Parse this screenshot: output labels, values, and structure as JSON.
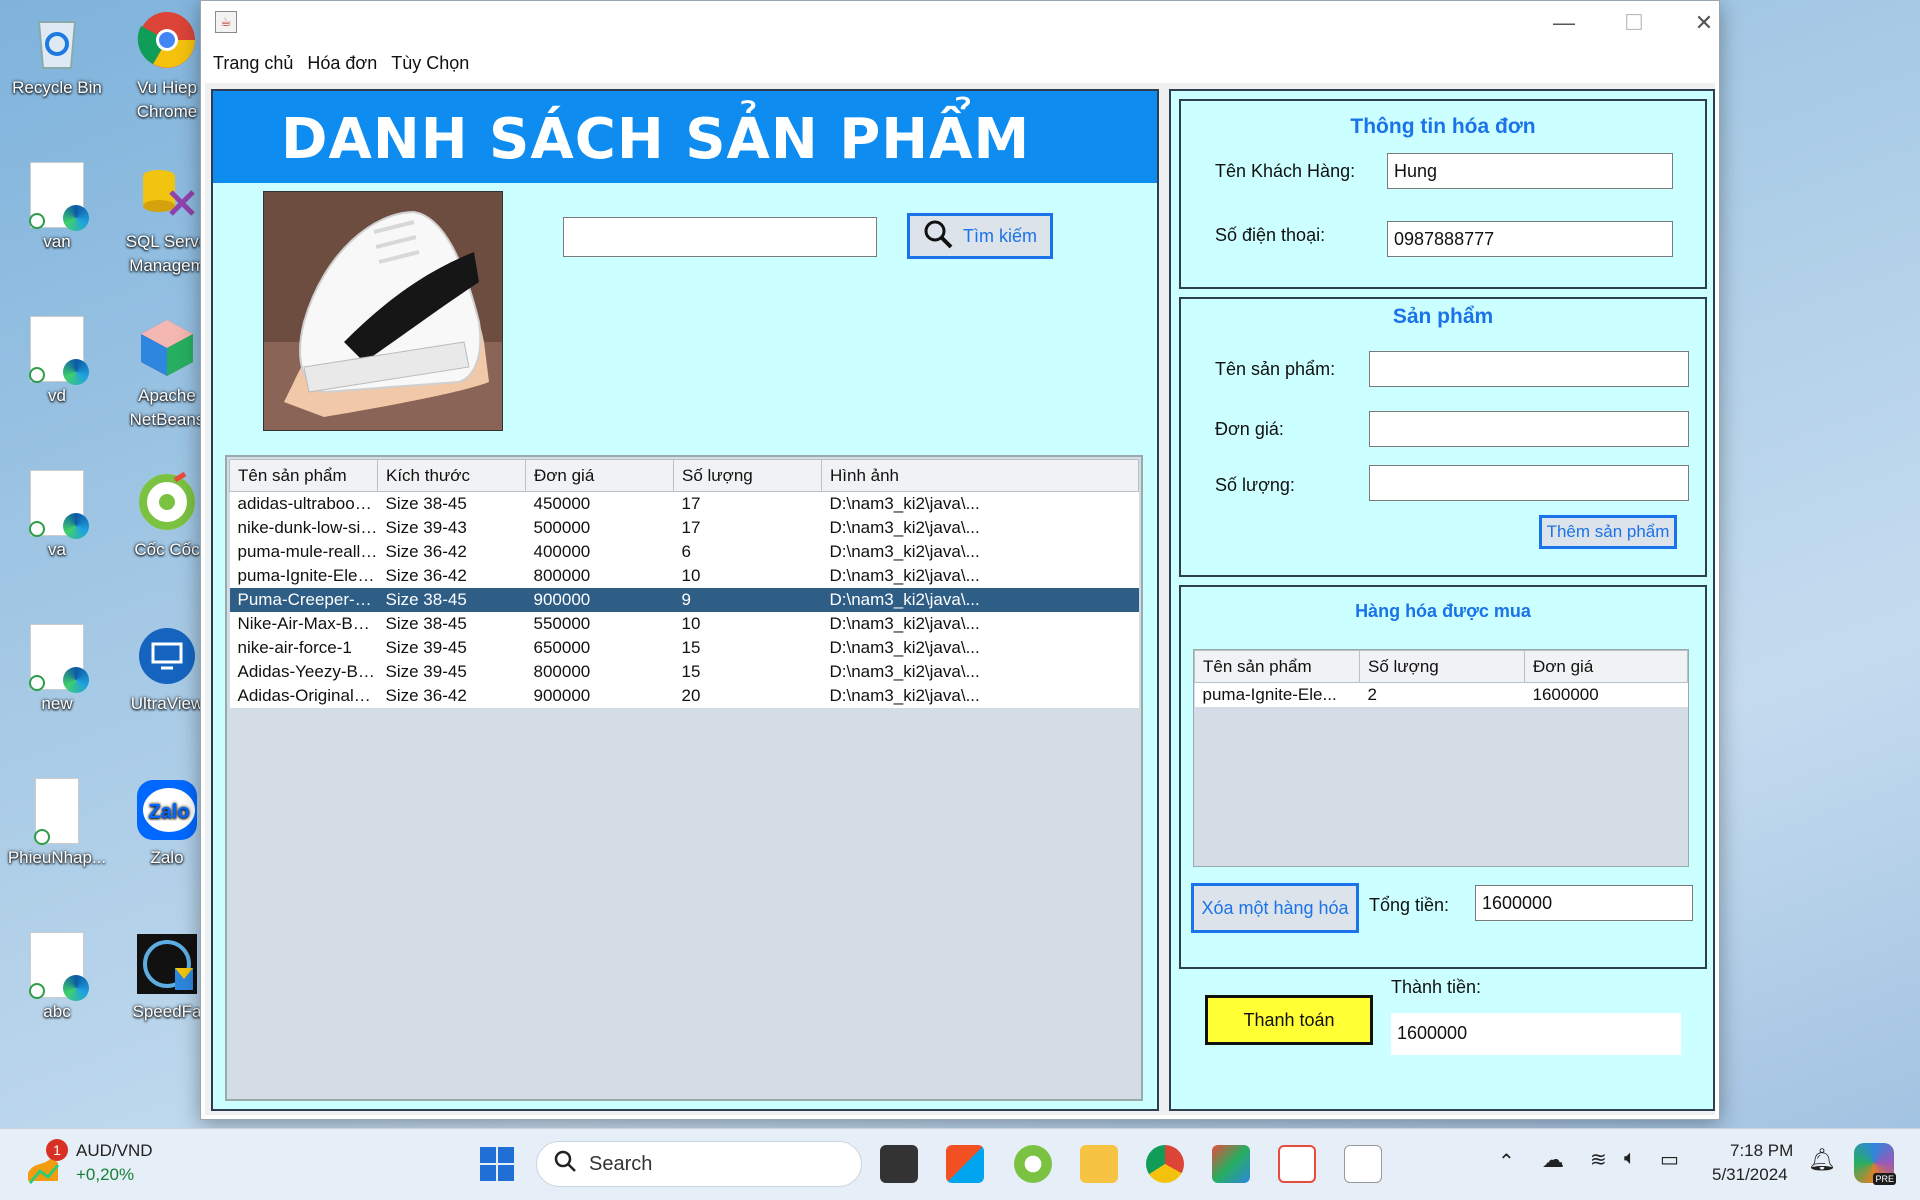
{
  "desktop": {
    "icons": [
      {
        "label": "Recycle Bin"
      },
      {
        "label": "Vu Hiep\nChrome"
      },
      {
        "label": "van"
      },
      {
        "label": "SQL Serve\nManagem"
      },
      {
        "label": "vd"
      },
      {
        "label": "Apache\nNetBeans"
      },
      {
        "label": "va"
      },
      {
        "label": "Cốc Cốc"
      },
      {
        "label": "new"
      },
      {
        "label": "UltraView"
      },
      {
        "label": "PhieuNhap..."
      },
      {
        "label": "Zalo"
      },
      {
        "label": "abc"
      },
      {
        "label": "SpeedFa"
      }
    ]
  },
  "window": {
    "menu": [
      "Trang chủ",
      "Hóa đơn",
      "Tùy Chọn"
    ],
    "controls": {
      "minimize": "—",
      "maximize": "☐",
      "close": "✕"
    }
  },
  "left": {
    "banner_title": "DANH SÁCH SẢN PHẨM",
    "search": {
      "value": "",
      "button_label": "Tìm kiếm"
    },
    "table": {
      "columns": [
        "Tên sản phẩm",
        "Kích thước",
        "Đơn giá",
        "Số lượng",
        "Hình ảnh"
      ],
      "rows": [
        [
          "adidas-ultraboost-20",
          "Size 38-45",
          "450000",
          "17",
          "D:\\nam3_ki2\\java\\..."
        ],
        [
          "nike-dunk-low-silv...",
          "Size 39-43",
          "500000",
          "17",
          "D:\\nam3_ki2\\java\\..."
        ],
        [
          "puma-mule-reallove",
          "Size 36-42",
          "400000",
          "6",
          "D:\\nam3_ki2\\java\\..."
        ],
        [
          "puma-Ignite-Eleva...",
          "Size 36-42",
          "800000",
          "10",
          "D:\\nam3_ki2\\java\\..."
        ],
        [
          "Puma-Creeper-Ri...",
          "Size 38-45",
          "900000",
          "9",
          "D:\\nam3_ki2\\java\\..."
        ],
        [
          "Nike-Air-Max-BW-...",
          "Size 38-45",
          "550000",
          "10",
          "D:\\nam3_ki2\\java\\..."
        ],
        [
          "nike-air-force-1",
          "Size 39-45",
          "650000",
          "15",
          "D:\\nam3_ki2\\java\\..."
        ],
        [
          "Adidas-Yeezy-Boo...",
          "Size 39-45",
          "800000",
          "15",
          "D:\\nam3_ki2\\java\\..."
        ],
        [
          "Adidas-Originals-...",
          "Size 36-42",
          "900000",
          "20",
          "D:\\nam3_ki2\\java\\..."
        ]
      ],
      "selected_row": 4
    }
  },
  "invoice": {
    "title": "Thông tin hóa đơn",
    "customer_label": "Tên Khách Hàng:",
    "customer_value": "Hung",
    "phone_label": "Số điện thoại:",
    "phone_value": "0987888777"
  },
  "product": {
    "title": "Sản phẩm",
    "name_label": "Tên sản phẩm:",
    "name_value": "",
    "price_label": "Đơn giá:",
    "price_value": "",
    "qty_label": "Số lượng:",
    "qty_value": "",
    "add_button": "Thêm sản phẩm"
  },
  "cart": {
    "title": "Hàng hóa được mua",
    "columns": [
      "Tên sản phẩm",
      "Số lượng",
      "Đơn giá"
    ],
    "rows": [
      [
        "puma-Ignite-Ele...",
        "2",
        "1600000"
      ]
    ],
    "remove_button": "Xóa một hàng hóa",
    "total_label": "Tổng tiền:",
    "total_value": "1600000"
  },
  "payment": {
    "pay_button": "Thanh toán",
    "amount_label": "Thành tiền:",
    "amount_value": "1600000"
  },
  "taskbar": {
    "widget_badge": "1",
    "widget_title": "AUD/VND",
    "widget_value": "+0,20%",
    "search_placeholder": "Search",
    "time": "7:18 PM",
    "date": "5/31/2024",
    "copilot_badge": "PRE"
  },
  "colors": {
    "panel_bg": "#ccffff",
    "banner": "#0f8cf0",
    "accent": "#1a73e8",
    "selected_row": "#2e5d86",
    "pay_button": "#ffff33"
  }
}
